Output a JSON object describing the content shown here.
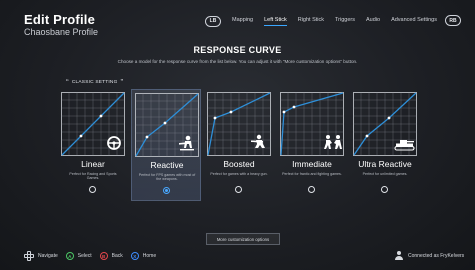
{
  "header": {
    "title": "Edit Profile",
    "subtitle": "Chaosbane Profile"
  },
  "nav": {
    "left_bumper": "LB",
    "right_bumper": "RB",
    "tabs": [
      {
        "label": "Mapping",
        "active": false
      },
      {
        "label": "Left Stick",
        "active": true
      },
      {
        "label": "Right Stick",
        "active": false
      },
      {
        "label": "Triggers",
        "active": false
      },
      {
        "label": "Audio",
        "active": false
      },
      {
        "label": "Advanced Settings",
        "active": false
      }
    ],
    "accent_color": "#3aa7ff"
  },
  "section": {
    "title": "RESPONSE CURVE",
    "description": "Choose a model for the response curve from the list below. You can adjust it with \"More customization options\" button."
  },
  "classic_setting": {
    "label": "CLASSIC SETTING"
  },
  "curves": [
    {
      "name": "Linear",
      "description": "Perfect for Racing and Sports Games.",
      "icon": "steering-wheel-icon",
      "selected": false
    },
    {
      "name": "Reactive",
      "description": "Perfect for FPS games with most of the weapons.",
      "icon": "soldier-aiming-icon",
      "selected": true
    },
    {
      "name": "Boosted",
      "description": "Perfect for games with a heavy gun.",
      "icon": "crouching-soldier-icon",
      "selected": false
    },
    {
      "name": "Immediate",
      "description": "Perfect for frantic and fighting games.",
      "icon": "fighters-icon",
      "selected": false
    },
    {
      "name": "Ultra Reactive",
      "description": "Perfect for unlimited games.",
      "icon": "tank-icon",
      "selected": false
    }
  ],
  "more_button": {
    "label": "More customization options"
  },
  "footer": {
    "navigate": "Navigate",
    "select": {
      "key": "A",
      "label": "Select",
      "color": "#4cc765"
    },
    "back": {
      "key": "B",
      "label": "Back",
      "color": "#e2464b"
    },
    "home": {
      "key": "X",
      "label": "Home",
      "color": "#3d8dff"
    },
    "connected": "Connected as FryKelvers"
  }
}
